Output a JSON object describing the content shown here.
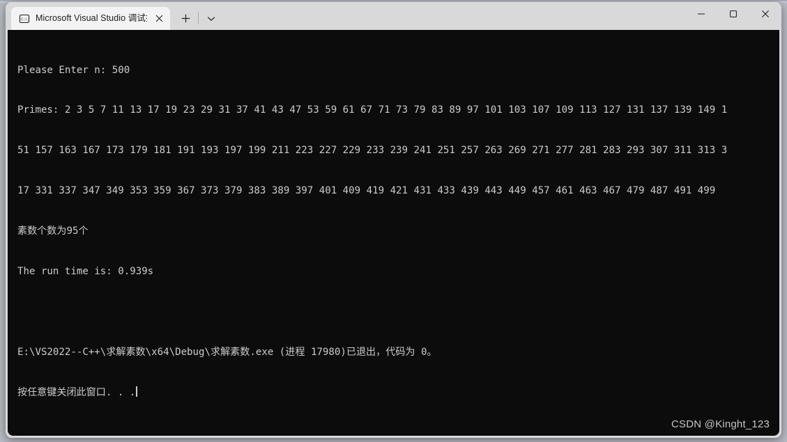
{
  "window": {
    "title_bar": {
      "tab": {
        "icon": "command-prompt-icon",
        "title": "Microsoft Visual Studio 调试控制台",
        "close_label": "✕"
      },
      "new_tab_label": "+",
      "dropdown_label": "⌄",
      "controls": {
        "minimize_label": "─",
        "maximize_label": "□",
        "close_label": "✕"
      }
    },
    "console": {
      "background_color": "#0c0c0c",
      "text_color": "#cccccc",
      "lines": [
        "Please Enter n: 500",
        "Primes: 2 3 5 7 11 13 17 19 23 29 31 37 41 43 47 53 59 61 67 71 73 79 83 89 97 101 103 107 109 113 127 131 137 139 149 1",
        "51 157 163 167 173 179 181 191 193 197 199 211 223 227 229 233 239 241 251 257 263 269 271 277 281 283 293 307 311 313 3",
        "17 331 337 347 349 353 359 367 373 379 383 389 397 401 409 419 421 431 433 439 443 449 457 461 463 467 479 487 491 499",
        "素数个数为95个",
        "The run time is: 0.939s",
        "",
        "E:\\VS2022--C++\\求解素数\\x64\\Debug\\求解素数.exe (进程 17980)已退出，代码为 0。",
        "按任意键关闭此窗口. . ."
      ],
      "prompt_value": "500",
      "prime_count": "95",
      "run_time": "0.939s",
      "process_id": "17980",
      "exit_code": "0",
      "exe_path": "E:\\VS2022--C++\\求解素数\\x64\\Debug\\求解素数.exe"
    }
  },
  "watermark": "CSDN @Kinght_123"
}
